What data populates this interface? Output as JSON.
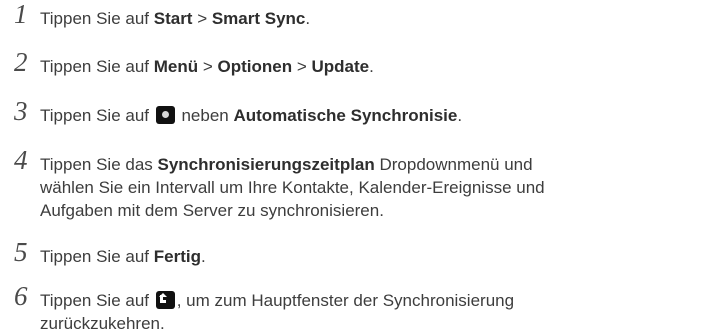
{
  "steps": [
    {
      "number": "1",
      "t1": "Tippen Sie auf ",
      "b1": "Start",
      "t2": " > ",
      "b2": "Smart Sync",
      "t3": "."
    },
    {
      "number": "2",
      "t1": "Tippen Sie auf ",
      "b1": "Menü",
      "t2": " > ",
      "b2": "Optionen",
      "t3": " > ",
      "b3": "Update",
      "t4": "."
    },
    {
      "number": "3",
      "t1": "Tippen Sie auf ",
      "icon": "toggle-icon",
      "t2": " neben ",
      "b1": "Automatische Synchronisie",
      "t3": "."
    },
    {
      "number": "4",
      "t1": "Tippen Sie das ",
      "b1": "Synchronisierungszeitplan",
      "t2": " Dropdownmenü und",
      "line2": "wählen Sie ein Intervall um Ihre Kontakte, Kalender-Ereignisse und",
      "line3": "Aufgaben mit dem Server zu synchronisieren."
    },
    {
      "number": "5",
      "t1": "Tippen Sie auf ",
      "b1": "Fertig",
      "t2": "."
    },
    {
      "number": "6",
      "t1": "Tippen Sie auf ",
      "icon": "back-icon",
      "t2": ", um zum Hauptfenster der Synchronisierung",
      "line2": "zurückzukehren."
    }
  ]
}
